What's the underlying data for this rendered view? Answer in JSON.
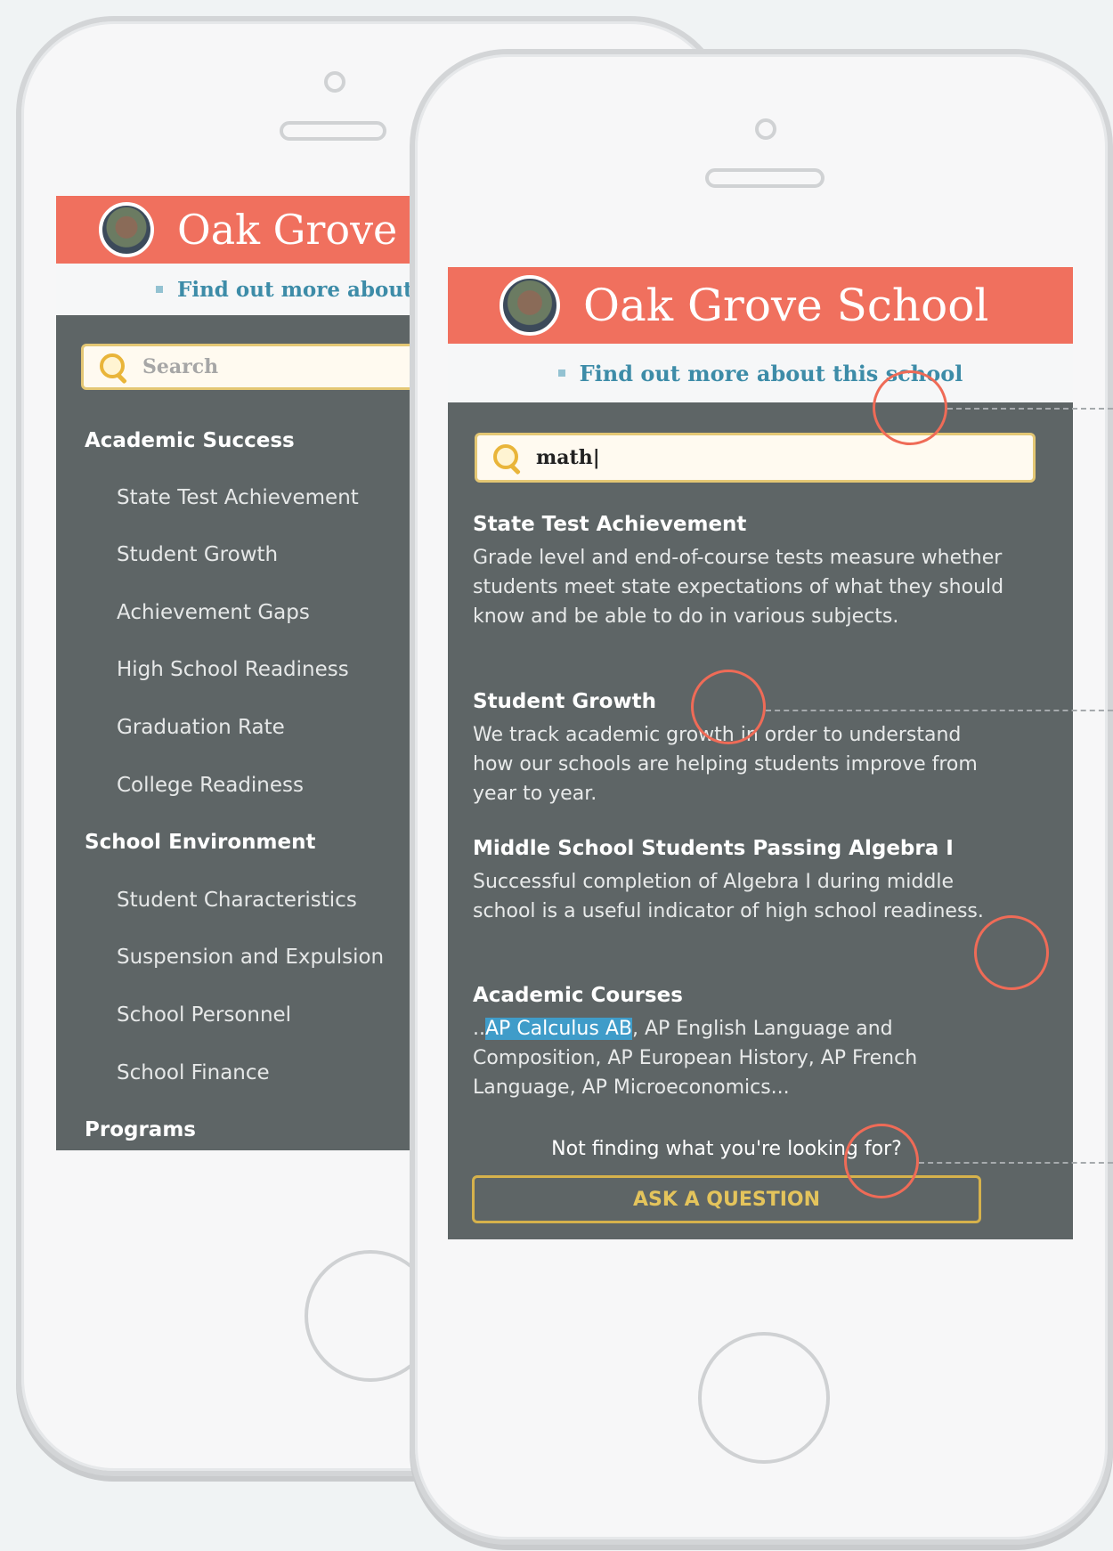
{
  "school": {
    "name": "Oak Grove School",
    "subtitle": "Find out more about this school"
  },
  "back_phone": {
    "search_placeholder": "Search",
    "nav": [
      {
        "label": "Academic Success",
        "type": "section"
      },
      {
        "label": "State Test Achievement",
        "type": "item"
      },
      {
        "label": "Student Growth",
        "type": "item"
      },
      {
        "label": "Achievement Gaps",
        "type": "item"
      },
      {
        "label": "High School Readiness",
        "type": "item"
      },
      {
        "label": "Graduation Rate",
        "type": "item"
      },
      {
        "label": "College Readiness",
        "type": "item"
      },
      {
        "label": "School Environment",
        "type": "section"
      },
      {
        "label": "Student Characteristics",
        "type": "item"
      },
      {
        "label": "Suspension and Expulsion",
        "type": "item"
      },
      {
        "label": "School Personnel",
        "type": "item"
      },
      {
        "label": "School Finance",
        "type": "item"
      },
      {
        "label": "Programs",
        "type": "section"
      }
    ]
  },
  "front_phone": {
    "search_value": "math|",
    "results": [
      {
        "title": "State Test Achievement",
        "body": "Grade level and end-of-course tests measure whether students meet state expectations of what they should know and be able to do in various subjects."
      },
      {
        "title": "Student Growth",
        "body": "We track academic growth in order to understand how our schools are helping students improve from year to year."
      },
      {
        "title": "Middle School Students Passing Algebra I",
        "body": "Successful completion of Algebra I during middle school is a useful indicator of high school readiness."
      },
      {
        "title": "Academic Courses",
        "body_prefix": "..",
        "body_highlight": "AP Calculus AB",
        "body_rest": ", AP English Language and Composition, AP European History, AP French Language, AP Microeconomics..."
      }
    ],
    "not_finding": "Not finding what you're looking for?",
    "ask_button": "ASK A QUESTION"
  },
  "colors": {
    "brand_coral": "#f0705e",
    "panel_gray": "#5e6566",
    "link_blue": "#3d8ca8",
    "search_border": "#e4c774",
    "highlight_blue": "#3f9cc9",
    "callout_red": "#ef6b57"
  },
  "icons": [
    "school-logo",
    "search-icon",
    "bullet-icon"
  ]
}
